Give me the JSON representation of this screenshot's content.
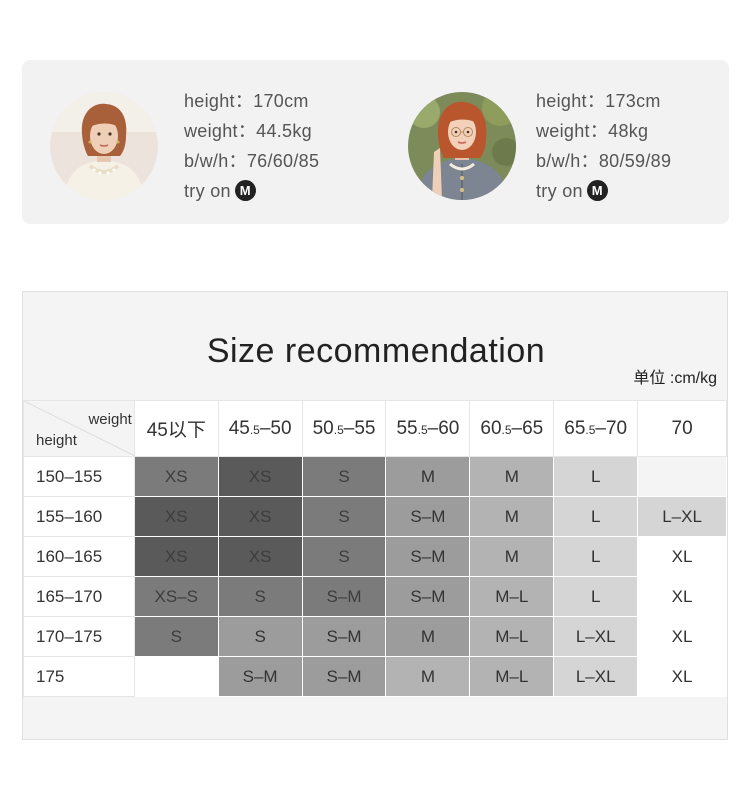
{
  "models": [
    {
      "height": "height：170cm",
      "weight": "weight：44.5kg",
      "bwh": "b/w/h：76/60/85",
      "try_on": "try on",
      "size_badge": "M"
    },
    {
      "height": "height：173cm",
      "weight": "weight：48kg",
      "bwh": "b/w/h：80/59/89",
      "try_on": "try on",
      "size_badge": "M"
    }
  ],
  "size_table": {
    "title": "Size recommendation",
    "unit": "单位 :cm/kg",
    "corner_weight": "weight",
    "corner_height": "height",
    "weight_columns": [
      {
        "main": "45以下",
        "pre": "",
        "sub": "",
        "post": ""
      },
      {
        "main": "",
        "pre": "45",
        "sub": ".5",
        "post": "–50"
      },
      {
        "main": "",
        "pre": "50",
        "sub": ".5",
        "post": "–55"
      },
      {
        "main": "",
        "pre": "55",
        "sub": ".5",
        "post": "–60"
      },
      {
        "main": "",
        "pre": "60",
        "sub": ".5",
        "post": "–65"
      },
      {
        "main": "",
        "pre": "65",
        "sub": ".5",
        "post": "–70"
      },
      {
        "main": "70",
        "pre": "",
        "sub": "",
        "post": ""
      }
    ],
    "rows": [
      {
        "height": "150–155",
        "cells": [
          "XS",
          "XS",
          "S",
          "M",
          "M",
          "L",
          ""
        ]
      },
      {
        "height": "155–160",
        "cells": [
          "XS",
          "XS",
          "S",
          "S–M",
          "M",
          "L",
          "L–XL"
        ]
      },
      {
        "height": "160–165",
        "cells": [
          "XS",
          "XS",
          "S",
          "S–M",
          "M",
          "L",
          "XL"
        ]
      },
      {
        "height": "165–170",
        "cells": [
          "XS–S",
          "S",
          "S–M",
          "S–M",
          "M–L",
          "L",
          "XL"
        ]
      },
      {
        "height": "170–175",
        "cells": [
          "S",
          "S",
          "S–M",
          "M",
          "M–L",
          "L–XL",
          "XL"
        ]
      },
      {
        "height": "175",
        "cells": [
          "",
          "S–M",
          "S–M",
          "M",
          "M–L",
          "L–XL",
          "XL"
        ]
      }
    ],
    "shades": [
      [
        "g2",
        "g1",
        "g2",
        "g3",
        "g4",
        "g5",
        "gE"
      ],
      [
        "g1",
        "g1",
        "g2",
        "g3",
        "g4",
        "g5",
        "g5"
      ],
      [
        "g1",
        "g1",
        "g2",
        "g3",
        "g4",
        "g5",
        "g6"
      ],
      [
        "g2",
        "g2",
        "g2",
        "g3",
        "g4",
        "g5",
        "g6"
      ],
      [
        "g2",
        "g3",
        "g3",
        "g3",
        "g4",
        "g5",
        "g6"
      ],
      [
        "g6",
        "g3",
        "g3",
        "g4",
        "g4",
        "g5",
        "g6"
      ]
    ]
  }
}
